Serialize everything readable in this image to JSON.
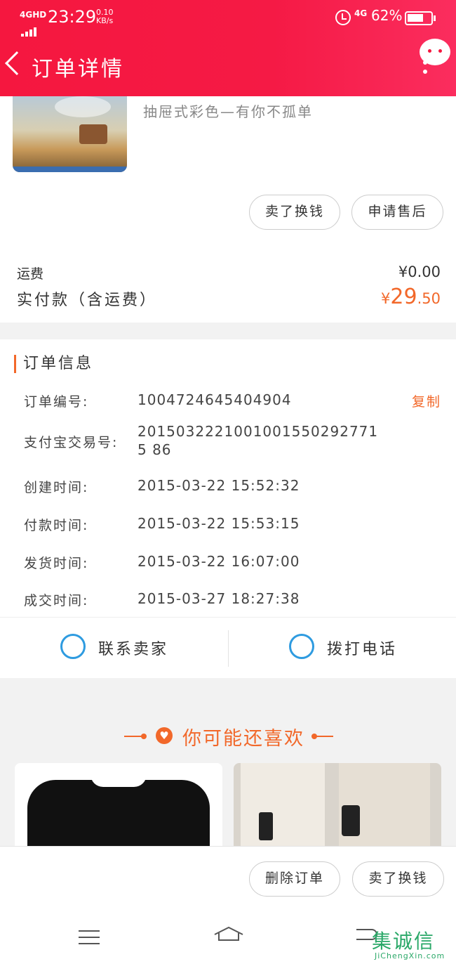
{
  "status_bar": {
    "signal": "4GHD",
    "time": "23:29",
    "speed_value": "0.10",
    "speed_unit": "KB/s",
    "network": "4G",
    "battery": "62%"
  },
  "header": {
    "title": "订单详情",
    "icon": "chat-bubble-icon"
  },
  "product": {
    "description": "抽屉式彩色—有你不孤单",
    "buttons": [
      "卖了换钱",
      "申请售后"
    ]
  },
  "fees": {
    "shipping_label": "运费",
    "shipping_value": "¥0.00",
    "paid_label": "实付款（含运费）",
    "paid_currency": "¥",
    "paid_int": "29",
    "paid_dec": ".50"
  },
  "order_info": {
    "title": "订单信息",
    "copy_label": "复制",
    "rows": [
      {
        "label": "订单编号:",
        "value": "1004724645404904"
      },
      {
        "label": "支付宝交易号:",
        "value": "20150322210010015502927715 86"
      },
      {
        "label": "创建时间:",
        "value": "2015-03-22 15:52:32"
      },
      {
        "label": "付款时间:",
        "value": "2015-03-22 15:53:15"
      },
      {
        "label": "发货时间:",
        "value": "2015-03-22 16:07:00"
      },
      {
        "label": "成交时间:",
        "value": "2015-03-27 18:27:38"
      }
    ]
  },
  "contact": {
    "seller_label": "联系卖家",
    "phone_label": "拨打电话"
  },
  "recommend": {
    "title": "你可能还喜欢"
  },
  "bottom_actions": {
    "delete_label": "删除订单",
    "sell_label": "卖了换钱"
  },
  "watermark": {
    "main": "集诚信",
    "sub": "JiChengXin.com"
  },
  "colors": {
    "header": "#f5173f",
    "accent": "#f2682a",
    "icon_blue": "#2e9be0"
  }
}
